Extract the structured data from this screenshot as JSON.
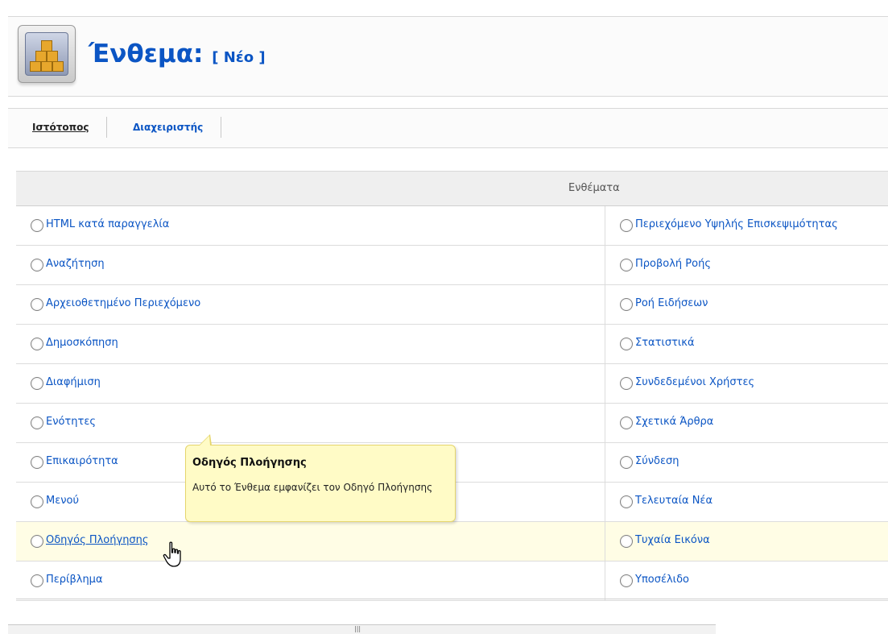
{
  "header": {
    "title": "Ένθεμα:",
    "subtitle": "[ Νέο ]",
    "icon": "module-boxes-icon"
  },
  "tabs": [
    {
      "label": "Ιστότοπος"
    },
    {
      "label": "Διαχειριστής"
    }
  ],
  "table": {
    "header": "Ενθέματα",
    "left": [
      "HTML κατά παραγγελία",
      "Αναζήτηση",
      "Αρχειοθετημένο Περιεχόμενο",
      "Δημοσκόπηση",
      "Διαφήμιση",
      "Ενότητες",
      "Επικαιρότητα",
      "Μενού",
      "Οδηγός Πλοήγησης",
      "Περίβλημα"
    ],
    "right": [
      "Περιεχόμενο Υψηλής Επισκεψιμότητας",
      "Προβολή Ροής",
      "Ροή Ειδήσεων",
      "Στατιστικά",
      "Συνδεδεμένοι Χρήστες",
      "Σχετικά Άρθρα",
      "Σύνδεση",
      "Τελευταία Νέα",
      "Τυχαία Εικόνα",
      "Υποσέλιδο"
    ]
  },
  "tooltip": {
    "title": "Οδηγός Πλοήγησης",
    "body": "Αυτό το Ένθεμα εμφανίζει τον Οδηγό Πλοήγησης"
  },
  "scrollbar": {
    "grip": "|||"
  },
  "colors": {
    "link": "#0b55c4",
    "highlight_row": "#fffde5",
    "tooltip_bg": "#fffbc6"
  }
}
